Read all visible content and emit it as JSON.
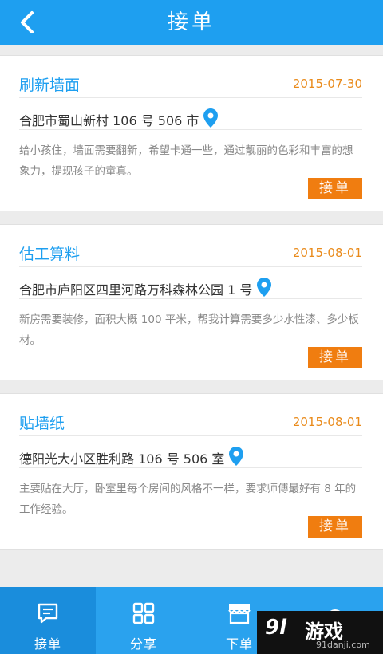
{
  "header": {
    "title": "接单"
  },
  "orders": [
    {
      "title": "刷新墙面",
      "date": "2015-07-30",
      "address": "合肥市蜀山新村 106 号 506 市",
      "description": "给小孩住，墙面需要翻新，希望卡通一些，通过靓丽的色彩和丰富的想象力，提现孩子的童真。",
      "button_label": "接单"
    },
    {
      "title": "估工算料",
      "date": "2015-08-01",
      "address": "合肥市庐阳区四里河路万科森林公园 1 号",
      "description": "新房需要装修，面积大概 100 平米，帮我计算需要多少水性漆、多少板材。",
      "button_label": "接单"
    },
    {
      "title": "贴墙纸",
      "date": "2015-08-01",
      "address": "德阳光大小区胜利路 106 号 506 室",
      "description": "主要贴在大厅，卧室里每个房间的风格不一样，要求师傅最好有 8 年的工作经验。",
      "button_label": "接单"
    }
  ],
  "tabbar": {
    "items": [
      {
        "label": "接单",
        "icon": "chat-icon",
        "active": true
      },
      {
        "label": "分享",
        "icon": "grid-icon",
        "active": false
      },
      {
        "label": "下单",
        "icon": "shop-icon",
        "active": false
      },
      {
        "label": "",
        "icon": "helmet-icon",
        "active": false
      }
    ]
  },
  "watermark": {
    "logo": "9l",
    "text": "游戏",
    "url": "91danji.com"
  },
  "colors": {
    "primary": "#1e9ff0",
    "accent": "#f07d10",
    "date": "#e98a1a"
  }
}
